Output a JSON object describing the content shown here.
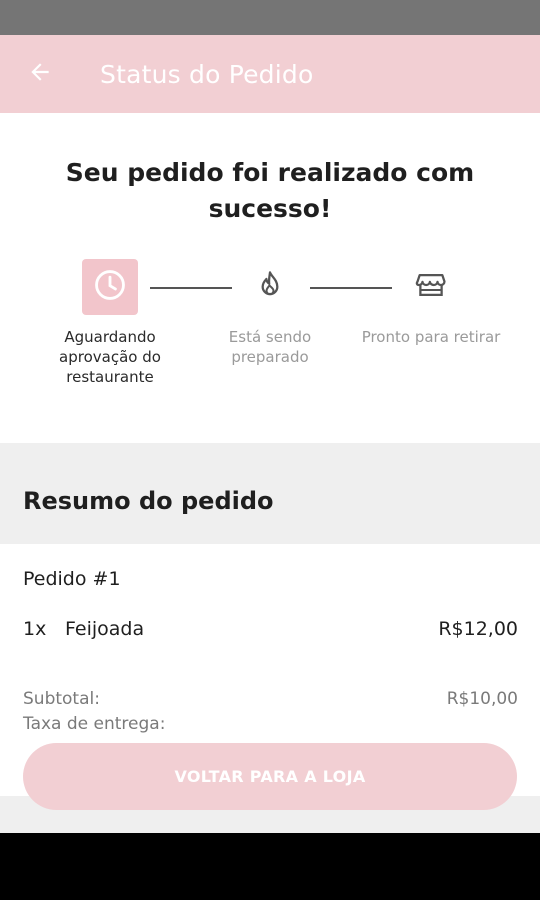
{
  "app_bar": {
    "title": "Status do Pedido",
    "back_icon": "arrow-left-icon",
    "background": "#f2cfd3"
  },
  "confirmation": {
    "headline": "Seu pedido foi realizado com sucesso!"
  },
  "progress_steps": [
    {
      "icon": "clock-icon",
      "label": "Aguardando aprovação do restaurante",
      "state": "active"
    },
    {
      "icon": "flame-icon",
      "label": "Está sendo preparado",
      "state": "pending"
    },
    {
      "icon": "storefront-icon",
      "label": "Pronto para retirar",
      "state": "pending"
    }
  ],
  "summary": {
    "title": "Resumo do pedido",
    "order_label": "Pedido #1",
    "items": [
      {
        "qty": "1x",
        "name": "Feijoada",
        "price": "R$12,00"
      }
    ],
    "subtotal_label": "Subtotal:",
    "subtotal_value": "R$10,00",
    "delivery_fee_label": "Taxa de entrega:"
  },
  "cta": {
    "label": "VOLTAR PARA A LOJA"
  },
  "colors": {
    "accent": "#f2cfd3",
    "active_step_bg": "#f2c5cb",
    "section_bg": "#efefef"
  }
}
